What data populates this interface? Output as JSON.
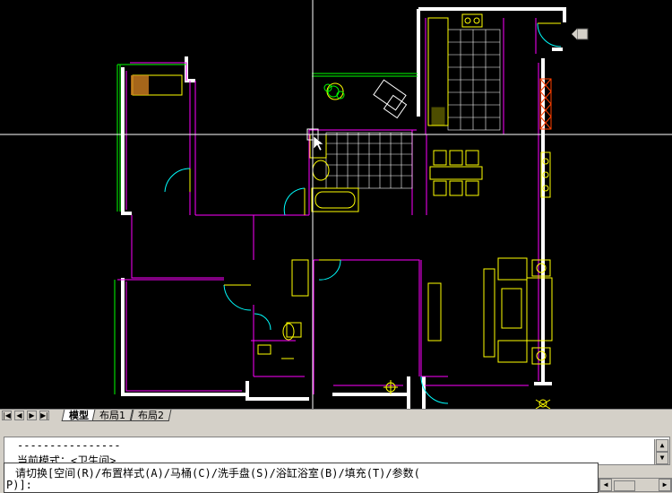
{
  "layout_tabs": [
    {
      "label": "模型",
      "active": true
    },
    {
      "label": "布局1",
      "active": false
    },
    {
      "label": "布局2",
      "active": false
    }
  ],
  "nav_icons": [
    "first-tab-icon",
    "prev-tab-icon",
    "next-tab-icon",
    "last-tab-icon"
  ],
  "nav_glyphs": [
    "|◀",
    "◀",
    "▶",
    "▶|"
  ],
  "command": {
    "history": [
      "----------------",
      "当前模式：<卫生间>"
    ],
    "prompt_line1": "请切换[空间(R)/布置样式(A)/马桶(C)/洗手盘(S)/浴缸浴室(B)/填充(T)/参数(",
    "prompt_line2": "P)]:"
  },
  "colors": {
    "canvas": "#000000",
    "wall": "#ffffff",
    "wall_edge": "#ff00ff",
    "furniture": "#ffff00",
    "window": "#00ff00",
    "grid": "#ffffff",
    "door": "#00ffff",
    "crosshair": "#ffffff"
  }
}
